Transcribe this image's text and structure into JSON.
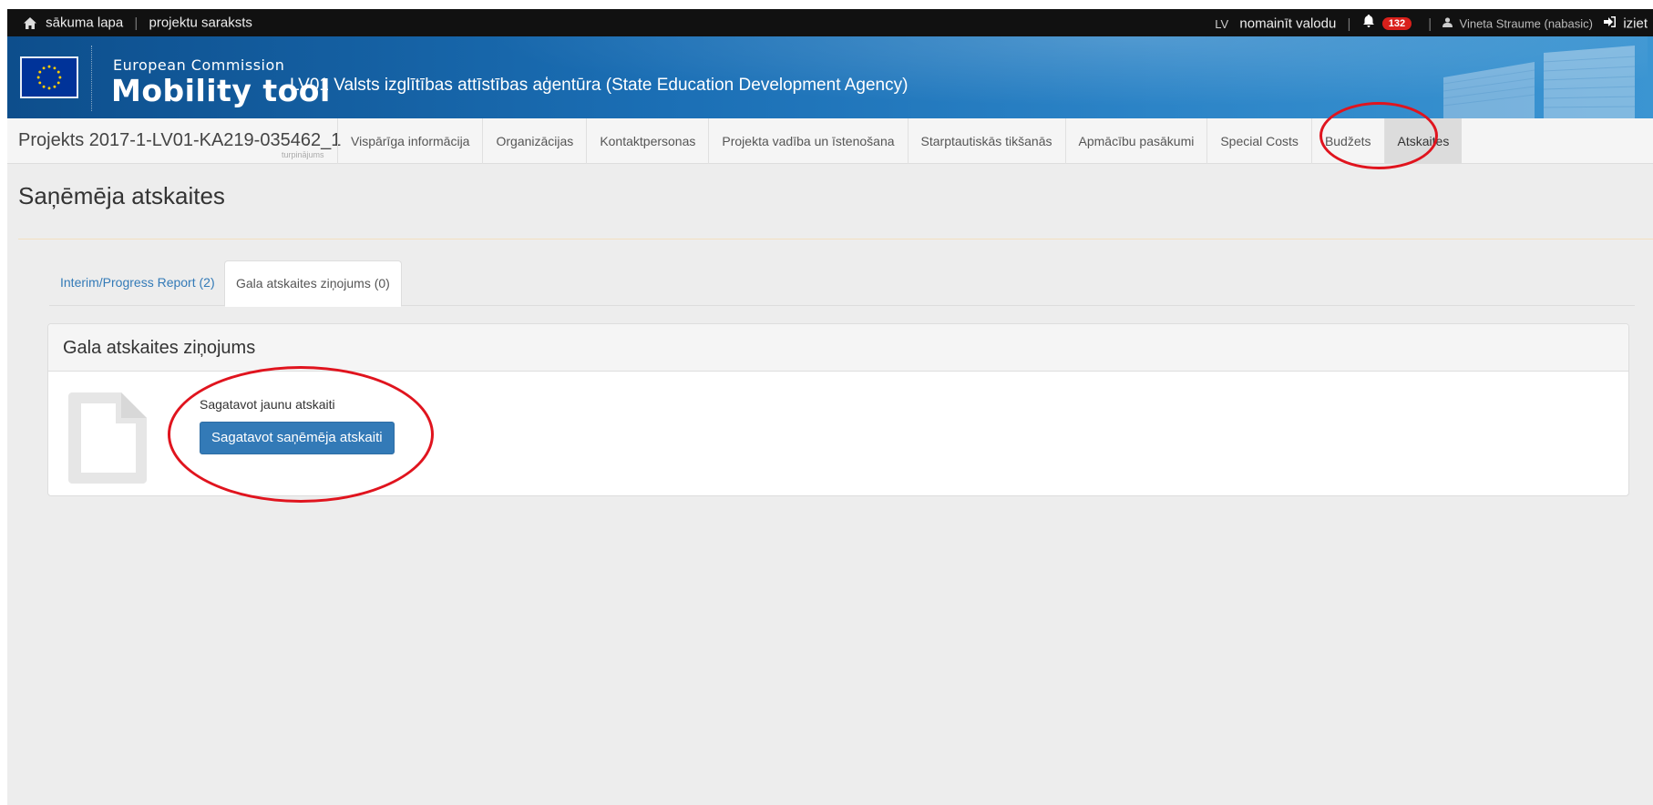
{
  "topbar": {
    "home_link": "sākuma lapa",
    "projects_link": "projektu saraksts",
    "lang_code": "LV",
    "change_language": "nomainīt valodu",
    "notification_count": "132",
    "user_name": "Vineta Straume (nabasic)",
    "logout": "iziet"
  },
  "banner": {
    "org": "European Commission",
    "app": "Mobility tool",
    "agency": "LV01 Valsts izglītības attīstības aģentūra (State Education Development Agency)"
  },
  "nav": {
    "project_id": "Projekts 2017-1-LV01-KA219-035462_1",
    "project_sub": "turpinājums",
    "items": [
      "Vispārīga informācija",
      "Organizācijas",
      "Kontaktpersonas",
      "Projekta vadība un īstenošana",
      "Starptautiskās tikšanās",
      "Apmācību pasākumi",
      "Special Costs",
      "Budžets",
      "Atskaites"
    ],
    "active_index": 8
  },
  "page": {
    "title": "Saņēmēja atskaites",
    "tabs": [
      "Interim/Progress Report (2)",
      "Gala atskaites ziņojums (0)"
    ],
    "active_tab": 1
  },
  "panel": {
    "heading": "Gala atskaites ziņojums",
    "create_label": "Sagatavot jaunu atskaiti",
    "create_button": "Sagatavot saņēmēja atskaiti"
  },
  "colors": {
    "topbar": "#111111",
    "banner": "#1b6fb5",
    "primary_button": "#337ab7",
    "badge": "#d9201b",
    "annotation": "#e0141e"
  },
  "icons": [
    "home-icon",
    "bell-icon",
    "user-icon",
    "logout-icon",
    "eu-flag-icon",
    "document-icon"
  ]
}
